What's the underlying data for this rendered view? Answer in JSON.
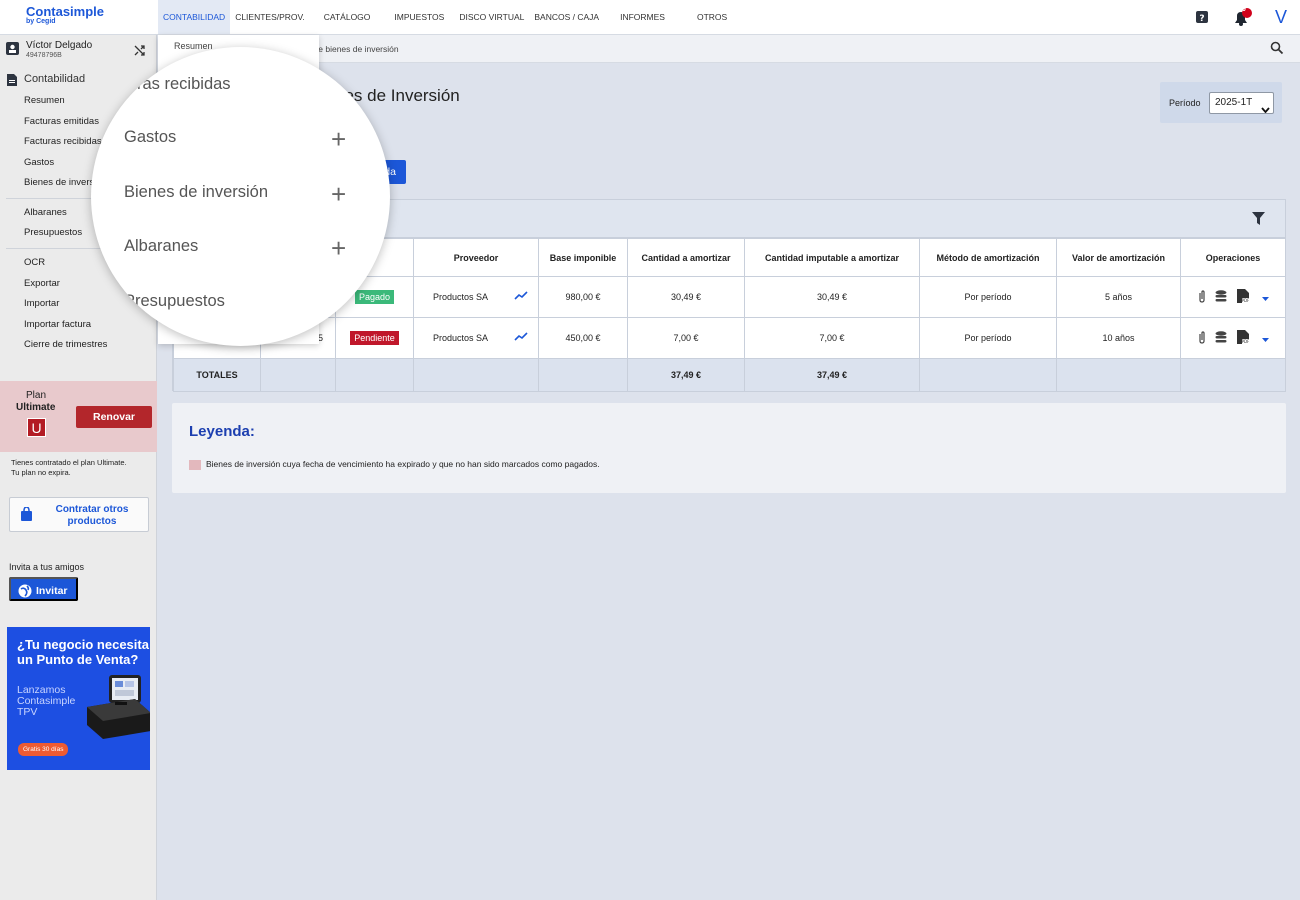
{
  "brand": {
    "name": "Contasimple",
    "by": "by Cegid",
    "color": "#1c57d8"
  },
  "nav": {
    "items": [
      {
        "label": "CONTABILIDAD"
      },
      {
        "label": "CLIENTES/PROV."
      },
      {
        "label": "CATÁLOGO"
      },
      {
        "label": "IMPUESTOS"
      },
      {
        "label": "DISCO VIRTUAL"
      },
      {
        "label": "BANCOS / CAJA"
      },
      {
        "label": "INFORMES"
      },
      {
        "label": "OTROS"
      }
    ],
    "notifications_count": "0",
    "account_initial": "V"
  },
  "user": {
    "name": "Víctor Delgado",
    "id": "49478796B"
  },
  "sidebar": {
    "section": "Contabilidad",
    "items": [
      {
        "label": "Resumen"
      },
      {
        "label": "Facturas emitidas"
      },
      {
        "label": "Facturas recibidas"
      },
      {
        "label": "Gastos"
      },
      {
        "label": "Bienes de inversión"
      },
      {
        "label": "Albaranes"
      },
      {
        "label": "Presupuestos"
      },
      {
        "label": "OCR"
      },
      {
        "label": "Exportar"
      },
      {
        "label": "Importar"
      },
      {
        "label": "Importar factura"
      },
      {
        "label": "Cierre de trimestres"
      }
    ]
  },
  "plan": {
    "label": "Plan",
    "name": "Ultimate",
    "badge": "U",
    "renew": "Renovar",
    "note1": "Tienes contratado el plan Ultimate.",
    "note2": "Tu plan no expira.",
    "other": "Contratar otros productos",
    "invite_text": "Invita a tus amigos",
    "invite_button": "Invitar"
  },
  "ad": {
    "headline": "¿Tu negocio necesita un Punto de Venta?",
    "sub": "Lanzamos Contasimple TPV",
    "cta": "Gratis 30 días"
  },
  "breadcrumb": {
    "current": "stro de bienes de inversión"
  },
  "page": {
    "title": "nes de Inversión",
    "periodo_label": "Período",
    "periodo_value": "2025-1T",
    "help_button": "yuda"
  },
  "table": {
    "columns": [
      "ado",
      "Proveedor",
      "Base imponible",
      "Cantidad a amortizar",
      "Cantidad imputable a amortizar",
      "Método de amortización",
      "Valor de amortización",
      "Operaciones"
    ],
    "rows": [
      {
        "num": "",
        "estado": "Pagado",
        "proveedor": "Productos SA",
        "base": "980,00 €",
        "cant": "30,49 €",
        "imput": "30,49 €",
        "metodo": "Por período",
        "valor": "5 años"
      },
      {
        "num": "5",
        "estado": "Pendiente",
        "proveedor": "Productos SA",
        "base": "450,00 €",
        "cant": "7,00 €",
        "imput": "7,00 €",
        "metodo": "Por período",
        "valor": "10 años"
      }
    ],
    "totals": {
      "label": "TOTALES",
      "cant": "37,49 €",
      "imput": "37,49 €"
    }
  },
  "legend": {
    "title": "Leyenda:",
    "text": "Bienes de inversión cuya fecha de vencimiento ha expirado y que no han sido marcados como pagados."
  },
  "dropdown": {
    "first": "Resumen"
  },
  "magnifier": {
    "items": [
      {
        "label": "cturas recibidas"
      },
      {
        "label": "Gastos"
      },
      {
        "label": "Bienes de inversión"
      },
      {
        "label": "Albaranes"
      },
      {
        "label": "Presupuestos"
      }
    ]
  }
}
